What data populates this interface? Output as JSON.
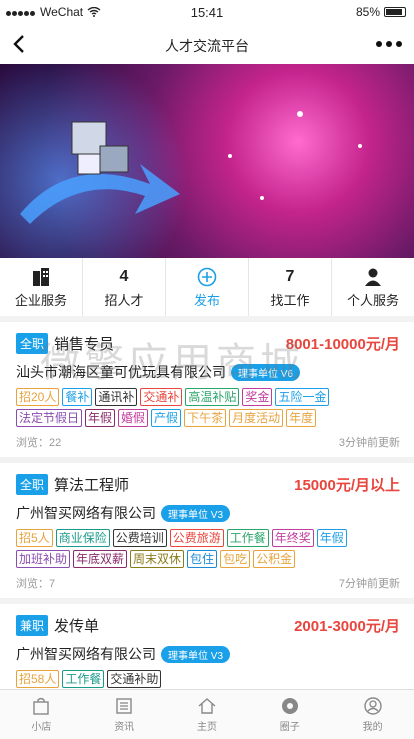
{
  "status": {
    "carrier": "WeChat",
    "time": "15:41",
    "battery": "85%"
  },
  "nav": {
    "title": "人才交流平台"
  },
  "quick": [
    {
      "label": "企业服务",
      "icon": "building-icon"
    },
    {
      "label": "招人才",
      "value": "4"
    },
    {
      "label": "发布",
      "icon": "plus-circle-icon"
    },
    {
      "label": "找工作",
      "value": "7"
    },
    {
      "label": "个人服务",
      "icon": "person-icon"
    }
  ],
  "jobs": [
    {
      "type": "全职",
      "title": "销售专员",
      "salary": "8001-10000元/月",
      "company": "汕头市潮海区童可优玩具有限公司",
      "badge": "理事单位 V6",
      "tags": [
        {
          "t": "招20人",
          "c": "#e8a33c"
        },
        {
          "t": "餐补",
          "c": "#1aa0e8"
        },
        {
          "t": "通讯补",
          "c": "#333"
        },
        {
          "t": "交通补",
          "c": "#e8453c"
        },
        {
          "t": "高温补贴",
          "c": "#2aa56a"
        },
        {
          "t": "奖金",
          "c": "#c23c9c"
        },
        {
          "t": "五险一金",
          "c": "#1aa0e8"
        },
        {
          "t": "法定节假日",
          "c": "#8a4caf"
        },
        {
          "t": "年假",
          "c": "#8a2a6a"
        },
        {
          "t": "婚假",
          "c": "#c23c9c"
        },
        {
          "t": "产假",
          "c": "#1aa0e8"
        },
        {
          "t": "下午茶",
          "c": "#e8a33c"
        },
        {
          "t": "月度活动",
          "c": "#e8a33c"
        },
        {
          "t": "年度",
          "c": "#e8a33c"
        }
      ],
      "views": "浏览：22",
      "time": "3分钟前更新"
    },
    {
      "type": "全职",
      "title": "算法工程师",
      "salary": "15000元/月以上",
      "company": "广州智买网络有限公司",
      "badge": "理事单位 V3",
      "tags": [
        {
          "t": "招5人",
          "c": "#e8a33c"
        },
        {
          "t": "商业保险",
          "c": "#1a9a8a"
        },
        {
          "t": "公费培训",
          "c": "#333"
        },
        {
          "t": "公费旅游",
          "c": "#e8453c"
        },
        {
          "t": "工作餐",
          "c": "#2aa56a"
        },
        {
          "t": "年终奖",
          "c": "#c23c9c"
        },
        {
          "t": "年假",
          "c": "#1aa0e8"
        },
        {
          "t": "加班补助",
          "c": "#8a4caf"
        },
        {
          "t": "年底双薪",
          "c": "#8a2a6a"
        },
        {
          "t": "周末双休",
          "c": "#8a7a1a"
        },
        {
          "t": "包住",
          "c": "#1a8ad8"
        },
        {
          "t": "包吃",
          "c": "#e8a33c"
        },
        {
          "t": "公积金",
          "c": "#e8a33c"
        }
      ],
      "views": "浏览：7",
      "time": "7分钟前更新"
    },
    {
      "type": "兼职",
      "title": "发传单",
      "salary": "2001-3000元/月",
      "company": "广州智买网络有限公司",
      "badge": "理事单位 V3",
      "tags": [
        {
          "t": "招58人",
          "c": "#e8a33c"
        },
        {
          "t": "工作餐",
          "c": "#1a9a8a"
        },
        {
          "t": "交通补助",
          "c": "#333"
        }
      ]
    }
  ],
  "tabs": [
    {
      "label": "小店",
      "icon": "shop-icon"
    },
    {
      "label": "资讯",
      "icon": "news-icon"
    },
    {
      "label": "主页",
      "icon": "home-icon"
    },
    {
      "label": "圈子",
      "icon": "circle-icon"
    },
    {
      "label": "我的",
      "icon": "user-icon"
    }
  ],
  "watermark": "微擎应用商城"
}
